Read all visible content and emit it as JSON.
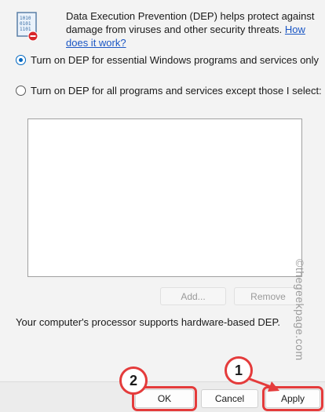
{
  "header": {
    "description": "Data Execution Prevention (DEP) helps protect against damage from viruses and other security threats.",
    "link_text": "How does it work?"
  },
  "options": [
    {
      "label": "Turn on DEP for essential Windows programs and services only",
      "checked": true
    },
    {
      "label": "Turn on DEP for all programs and services except those I select:",
      "checked": false
    }
  ],
  "list_buttons": {
    "add_label": "Add...",
    "remove_label": "Remove"
  },
  "status_text": "Your computer's processor supports hardware-based DEP.",
  "footer": {
    "ok_label": "OK",
    "cancel_label": "Cancel",
    "apply_label": "Apply"
  },
  "annotations": {
    "badge_1": "1",
    "badge_2": "2",
    "accent_color": "#e43b3b"
  },
  "watermark": "©thegeekpage.com"
}
